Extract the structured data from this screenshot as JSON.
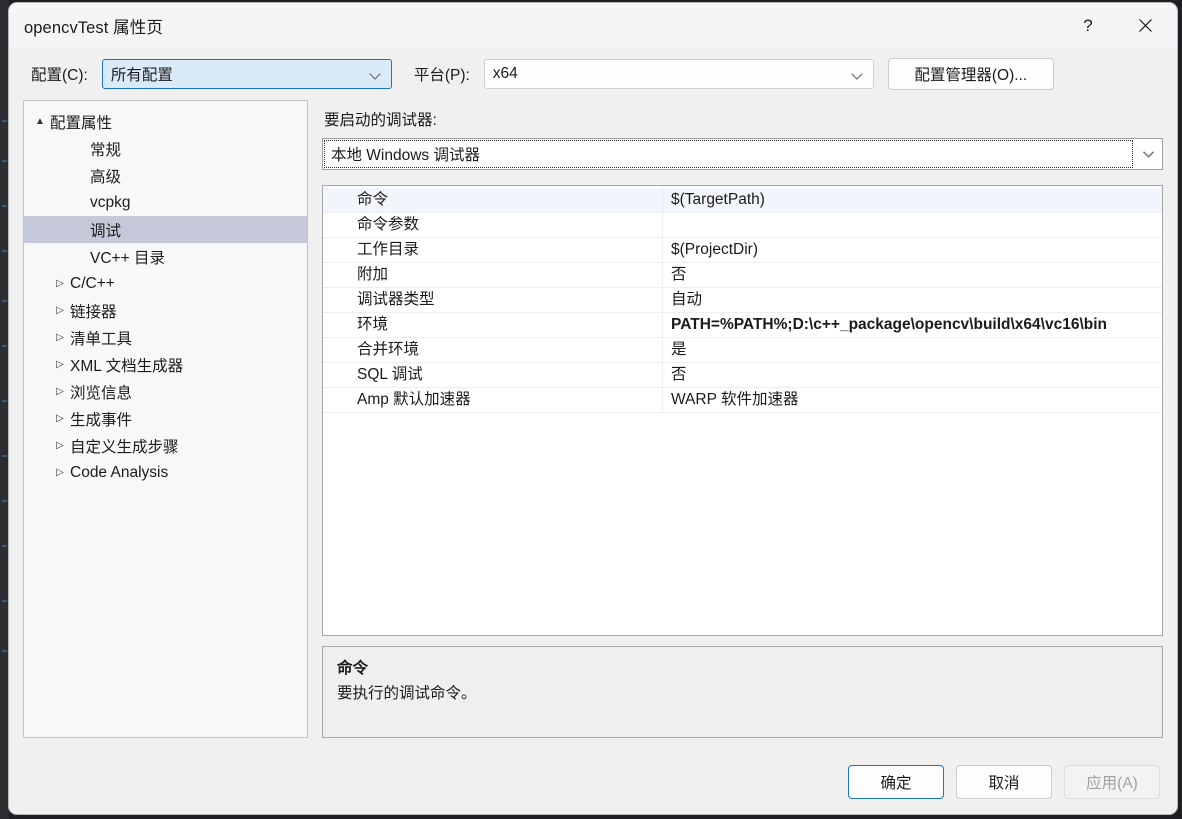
{
  "window": {
    "title": "opencvTest 属性页",
    "help_label": "?",
    "close_label": "✕"
  },
  "configbar": {
    "config_label": "配置(C):",
    "config_value": "所有配置",
    "platform_label": "平台(P):",
    "platform_value": "x64",
    "config_manager_label": "配置管理器(O)..."
  },
  "tree": {
    "items": [
      {
        "label": "配置属性",
        "level": 0,
        "arrow": "▲",
        "selected": false
      },
      {
        "label": "常规",
        "level": 1,
        "arrow": "",
        "selected": false
      },
      {
        "label": "高级",
        "level": 1,
        "arrow": "",
        "selected": false
      },
      {
        "label": "vcpkg",
        "level": 1,
        "arrow": "",
        "selected": false
      },
      {
        "label": "调试",
        "level": 1,
        "arrow": "",
        "selected": true
      },
      {
        "label": "VC++ 目录",
        "level": 1,
        "arrow": "",
        "selected": false
      },
      {
        "label": "C/C++",
        "level": 1,
        "arrow": "▷",
        "selected": false
      },
      {
        "label": "链接器",
        "level": 1,
        "arrow": "▷",
        "selected": false
      },
      {
        "label": "清单工具",
        "level": 1,
        "arrow": "▷",
        "selected": false
      },
      {
        "label": "XML 文档生成器",
        "level": 1,
        "arrow": "▷",
        "selected": false
      },
      {
        "label": "浏览信息",
        "level": 1,
        "arrow": "▷",
        "selected": false
      },
      {
        "label": "生成事件",
        "level": 1,
        "arrow": "▷",
        "selected": false
      },
      {
        "label": "自定义生成步骤",
        "level": 1,
        "arrow": "▷",
        "selected": false
      },
      {
        "label": "Code Analysis",
        "level": 1,
        "arrow": "▷",
        "selected": false
      }
    ]
  },
  "panel": {
    "caption": "要启动的调试器:",
    "debugger_value": "本地 Windows 调试器",
    "rows": [
      {
        "name": "命令",
        "value": "$(TargetPath)",
        "bold": false,
        "selected": true
      },
      {
        "name": "命令参数",
        "value": "",
        "bold": false,
        "selected": false
      },
      {
        "name": "工作目录",
        "value": "$(ProjectDir)",
        "bold": false,
        "selected": false
      },
      {
        "name": "附加",
        "value": "否",
        "bold": false,
        "selected": false
      },
      {
        "name": "调试器类型",
        "value": "自动",
        "bold": false,
        "selected": false
      },
      {
        "name": "环境",
        "value": "PATH=%PATH%;D:\\c++_package\\opencv\\build\\x64\\vc16\\bin",
        "bold": true,
        "selected": false
      },
      {
        "name": "合并环境",
        "value": "是",
        "bold": false,
        "selected": false
      },
      {
        "name": "SQL 调试",
        "value": "否",
        "bold": false,
        "selected": false
      },
      {
        "name": "Amp 默认加速器",
        "value": "WARP 软件加速器",
        "bold": false,
        "selected": false
      }
    ],
    "description": {
      "title": "命令",
      "text": "要执行的调试命令。"
    }
  },
  "footer": {
    "ok_label": "确定",
    "cancel_label": "取消",
    "apply_label": "应用(A)"
  },
  "colors": {
    "accent": "#1b74c7",
    "tree_selection": "#c5c8d8",
    "grid_selection": "#f2f5fb",
    "dialog_bg": "#f0f0f0"
  }
}
